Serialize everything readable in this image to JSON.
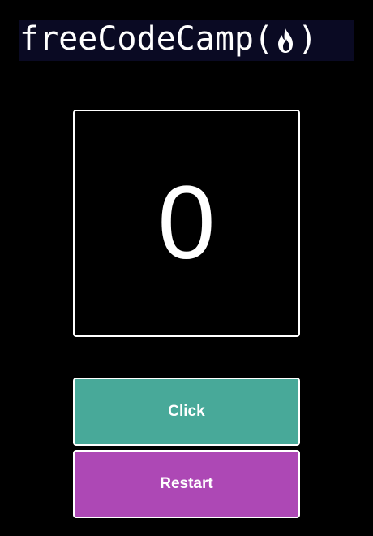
{
  "header": {
    "logo_text": "freeCodeCamp",
    "logo_open_paren": "(",
    "logo_close_paren": ")",
    "logo_icon": "flame-icon"
  },
  "counter": {
    "value": "0"
  },
  "buttons": {
    "click_label": "Click",
    "restart_label": "Restart"
  },
  "colors": {
    "background": "#000000",
    "logo_background": "#0a0a23",
    "click_button": "#48a999",
    "restart_button": "#ad48b5",
    "border": "#ffffff",
    "text": "#ffffff"
  }
}
